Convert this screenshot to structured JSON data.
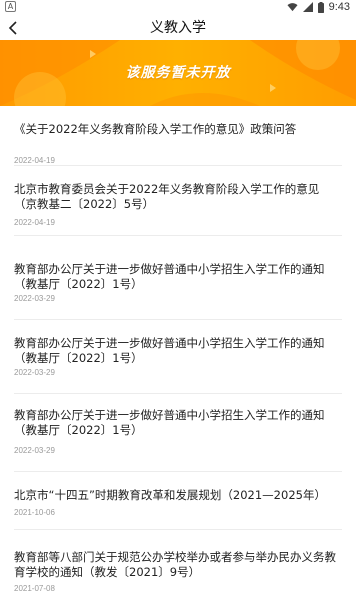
{
  "status_bar": {
    "left_badge": "A",
    "time": "9:43"
  },
  "header": {
    "title": "义教入学"
  },
  "banner": {
    "text": "该服务暂未开放"
  },
  "notices": [
    {
      "title": "《关于2022年义务教育阶段入学工作的意见》政策问答",
      "date": "2022-04-19"
    },
    {
      "title": "北京市教育委员会关于2022年义务教育阶段入学工作的意见（京教基二〔2022〕5号）",
      "date": "2022-04-19"
    },
    {
      "title": "教育部办公厅关于进一步做好普通中小学招生入学工作的通知（教基厅〔2022〕1号）",
      "date": "2022-03-29"
    },
    {
      "title": "教育部办公厅关于进一步做好普通中小学招生入学工作的通知（教基厅〔2022〕1号）",
      "date": "2022-03-29"
    },
    {
      "title": "教育部办公厅关于进一步做好普通中小学招生入学工作的通知（教基厅〔2022〕1号）",
      "date": "2022-03-29"
    },
    {
      "title": "北京市“十四五”时期教育改革和发展规划（2021—2025年）",
      "date": "2021-10-06"
    },
    {
      "title": "教育部等八部门关于规范公办学校举办或者参与举办民办义务教育学校的通知（教发〔2021〕9号）",
      "date": "2021-07-08"
    }
  ]
}
